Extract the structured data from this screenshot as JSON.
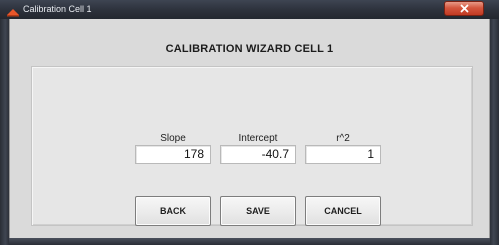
{
  "window": {
    "title": "Calibration Cell 1",
    "close_glyph": "✕"
  },
  "heading": "CALIBRATION WIZARD CELL 1",
  "fields": [
    {
      "label": "Slope",
      "value": "178"
    },
    {
      "label": "Intercept",
      "value": "-40.7"
    },
    {
      "label": "r^2",
      "value": "1"
    }
  ],
  "buttons": {
    "back": "BACK",
    "save": "SAVE",
    "cancel": "CANCEL"
  },
  "icons": {
    "app": "app-icon",
    "close": "close-icon"
  }
}
